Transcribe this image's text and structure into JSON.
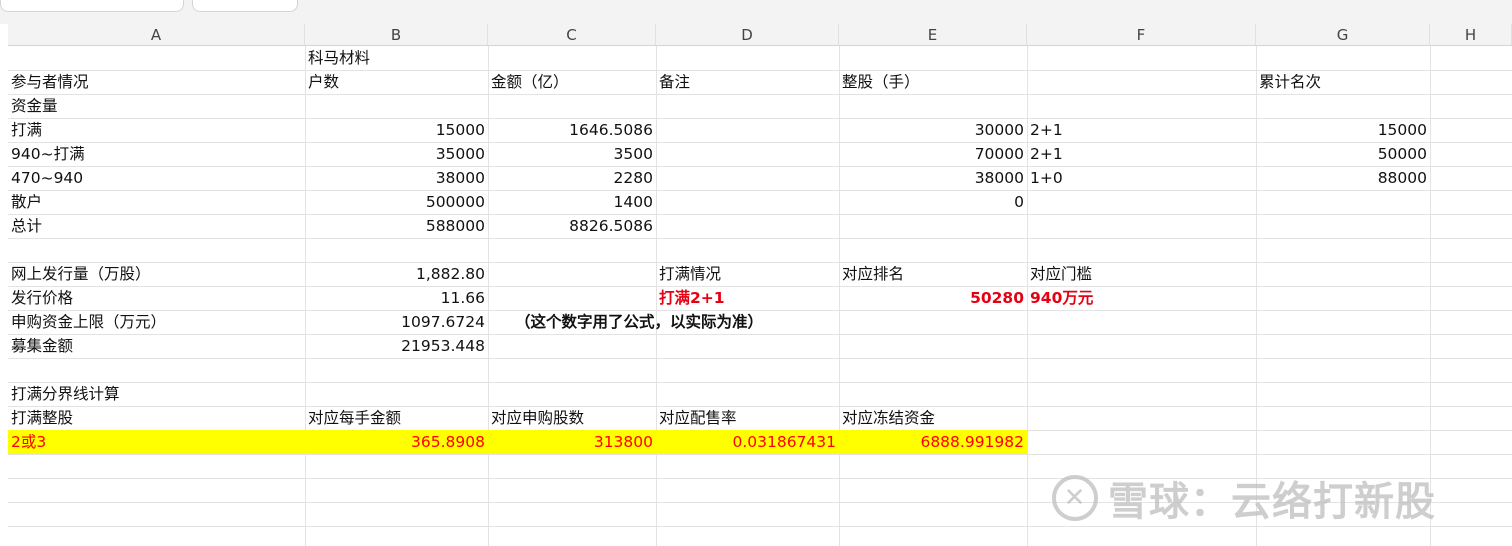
{
  "columns": [
    "A",
    "B",
    "C",
    "D",
    "E",
    "F",
    "G",
    "H"
  ],
  "rows": {
    "r1": {
      "B": "科马材料"
    },
    "r2": {
      "A": "参与者情况",
      "B": "户数",
      "C": "金额（亿）",
      "D": "备注",
      "E": "整股（手）",
      "G": "累计名次"
    },
    "r3": {
      "A": "资金量"
    },
    "r4": {
      "A": "打满",
      "B": "15000",
      "C": "1646.5086",
      "E": "30000",
      "F": "2+1",
      "G": "15000"
    },
    "r5": {
      "A": "940~打满",
      "B": "35000",
      "C": "3500",
      "E": "70000",
      "F": "2+1",
      "G": "50000"
    },
    "r6": {
      "A": "470~940",
      "B": "38000",
      "C": "2280",
      "E": "38000",
      "F": "1+0",
      "G": "88000"
    },
    "r7": {
      "A": "散户",
      "B": "500000",
      "C": "1400",
      "E": "0"
    },
    "r8": {
      "A": "总计",
      "B": "588000",
      "C": "8826.5086"
    },
    "r10": {
      "A": "网上发行量（万股）",
      "B": "1,882.80",
      "D": "打满情况",
      "E": "对应排名",
      "F": "对应门槛"
    },
    "r11": {
      "A": "发行价格",
      "B": "11.66",
      "D": "打满2+1",
      "E": "50280",
      "F": "940万元"
    },
    "r12": {
      "A": "申购资金上限（万元）",
      "B": "1097.6724",
      "C": "（这个数字用了公式，以实际为准）"
    },
    "r13": {
      "A": "募集金额",
      "B": "21953.448"
    },
    "r15": {
      "A": "打满分界线计算"
    },
    "r16": {
      "A": "打满整股",
      "B": "对应每手金额",
      "C": "对应申购股数",
      "D": "对应配售率",
      "E": "对应冻结资金"
    },
    "r17": {
      "A": "2或3",
      "B": "365.8908",
      "C": "313800",
      "D": "0.031867431",
      "E": "6888.991982"
    }
  },
  "watermark": {
    "icon": "snowball-logo-icon",
    "text": "雪球：云络打新股"
  },
  "colors": {
    "highlight": "#ffff00",
    "red_text": "#e60012"
  }
}
